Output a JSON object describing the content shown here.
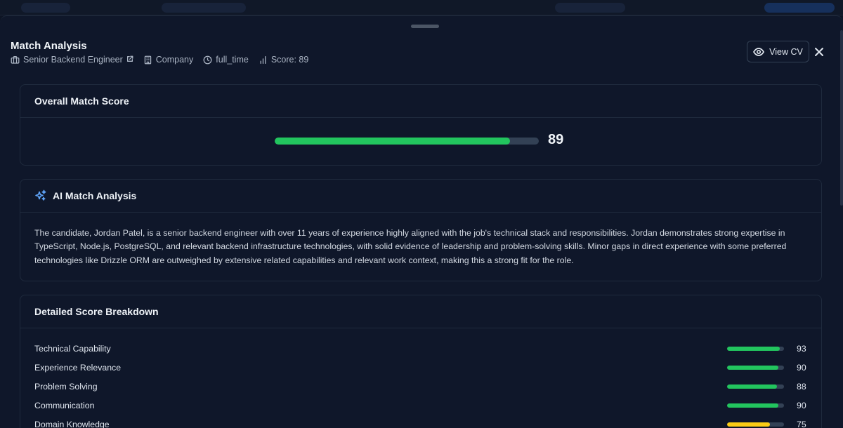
{
  "header": {
    "title": "Match Analysis",
    "job_title": "Senior Backend Engineer",
    "company": "Company",
    "employment_type": "full_time",
    "score_label": "Score: 89",
    "view_cv_label": "View CV"
  },
  "overall": {
    "title": "Overall Match Score",
    "score": 89,
    "score_text": "89"
  },
  "analysis": {
    "title": "AI Match Analysis",
    "text": "The candidate, Jordan Patel, is a senior backend engineer with over 11 years of experience highly aligned with the job's technical stack and responsibilities. Jordan demonstrates strong expertise in TypeScript, Node.js, PostgreSQL, and relevant backend infrastructure technologies, with solid evidence of leadership and problem-solving skills. Minor gaps in direct experience with some preferred technologies like Drizzle ORM are outweighed by extensive related capabilities and relevant work context, making this a strong fit for the role."
  },
  "breakdown": {
    "title": "Detailed Score Breakdown",
    "items": [
      {
        "label": "Technical Capability",
        "value": 93,
        "value_text": "93"
      },
      {
        "label": "Experience Relevance",
        "value": 90,
        "value_text": "90"
      },
      {
        "label": "Problem Solving",
        "value": 88,
        "value_text": "88"
      },
      {
        "label": "Communication",
        "value": 90,
        "value_text": "90"
      },
      {
        "label": "Domain Knowledge",
        "value": 75,
        "value_text": "75"
      }
    ]
  },
  "colors": {
    "high": "#22c55e",
    "medium": "#facc15",
    "accent": "#60a5fa"
  }
}
